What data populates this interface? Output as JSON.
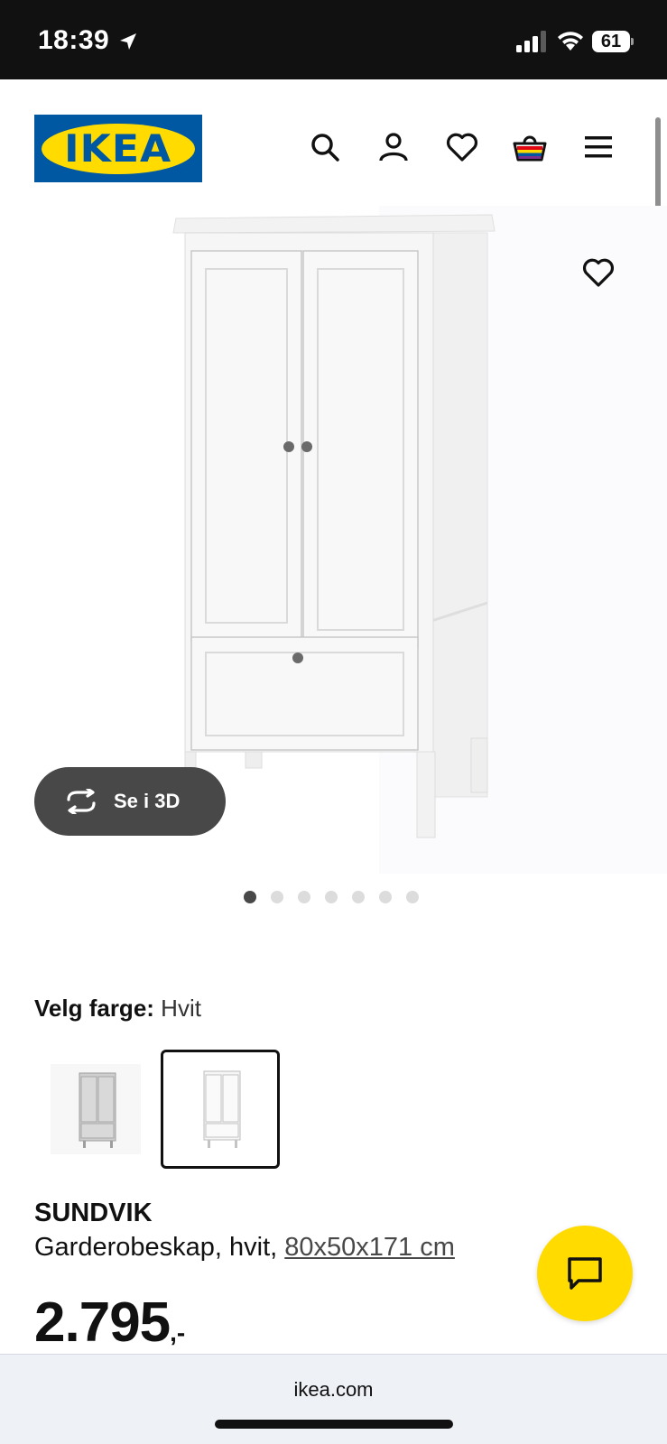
{
  "status_bar": {
    "time": "18:39",
    "battery": "61"
  },
  "header": {
    "logo_text": "IKEA",
    "icons": [
      "search-icon",
      "user-icon",
      "heart-icon",
      "basket-icon",
      "menu-icon"
    ]
  },
  "gallery": {
    "view_3d_label": "Se i 3D",
    "dot_count": 7,
    "active_dot": 1
  },
  "color_select": {
    "label": "Velg farge:",
    "value": "Hvit"
  },
  "product": {
    "name": "SUNDVIK",
    "description": "Garderobeskap, hvit,",
    "size": "80x50x171 cm",
    "price": "2.795",
    "price_suffix": ",-"
  },
  "browser": {
    "url": "ikea.com"
  },
  "colors": {
    "ikea_blue": "#0058a3",
    "ikea_yellow": "#ffdb00",
    "dark_button": "#484848"
  }
}
